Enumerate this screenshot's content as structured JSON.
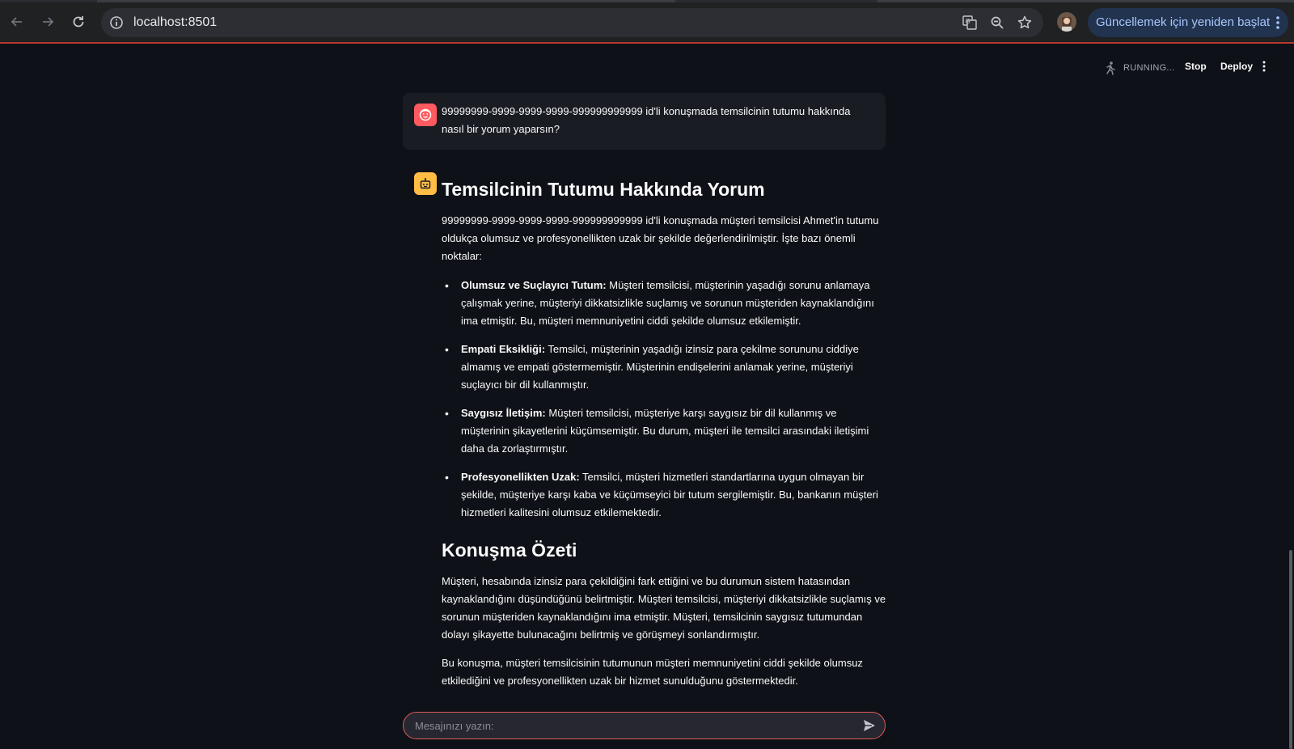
{
  "browser": {
    "url": "localhost:8501",
    "update_button_label": "Güncellemek için yeniden başlat"
  },
  "header": {
    "status_text": "RUNNING...",
    "stop_label": "Stop",
    "deploy_label": "Deploy"
  },
  "user_message": {
    "text": "99999999-9999-9999-9999-999999999999 id'li konuşmada temsilcinin tutumu hakkında nasıl bir yorum yaparsın?"
  },
  "assistant_message": {
    "heading": "Temsilcinin Tutumu Hakkında Yorum",
    "intro": "99999999-9999-9999-9999-999999999999 id'li konuşmada müşteri temsilcisi Ahmet'in tutumu oldukça olumsuz ve profesyonellikten uzak bir şekilde değerlendirilmiştir. İşte bazı önemli noktalar:",
    "points": [
      {
        "title": "Olumsuz ve Suçlayıcı Tutum:",
        "text": " Müşteri temsilcisi, müşterinin yaşadığı sorunu anlamaya çalışmak yerine, müşteriyi dikkatsizlikle suçlamış ve sorunun müşteriden kaynaklandığını ima etmiştir. Bu, müşteri memnuniyetini ciddi şekilde olumsuz etkilemiştir."
      },
      {
        "title": "Empati Eksikliği:",
        "text": " Temsilci, müşterinin yaşadığı izinsiz para çekilme sorununu ciddiye almamış ve empati göstermemiştir. Müşterinin endişelerini anlamak yerine, müşteriyi suçlayıcı bir dil kullanmıştır."
      },
      {
        "title": "Saygısız İletişim:",
        "text": " Müşteri temsilcisi, müşteriye karşı saygısız bir dil kullanmış ve müşterinin şikayetlerini küçümsemiştir. Bu durum, müşteri ile temsilci arasındaki iletişimi daha da zorlaştırmıştır."
      },
      {
        "title": "Profesyonellikten Uzak:",
        "text": " Temsilci, müşteri hizmetleri standartlarına uygun olmayan bir şekilde, müşteriye karşı kaba ve küçümseyici bir tutum sergilemiştir. Bu, bankanın müşteri hizmetleri kalitesini olumsuz etkilemektedir."
      }
    ],
    "summary_heading": "Konuşma Özeti",
    "summary_p1": "Müşteri, hesabında izinsiz para çekildiğini fark ettiğini ve bu durumun sistem hatasından kaynaklandığını düşündüğünü belirtmiştir. Müşteri temsilcisi, müşteriyi dikkatsizlikle suçlamış ve sorunun müşteriden kaynaklandığını ima etmiştir. Müşteri, temsilcinin saygısız tutumundan dolayı şikayette bulunacağını belirtmiş ve görüşmeyi sonlandırmıştır.",
    "summary_p2": "Bu konuşma, müşteri temsilcisinin tutumunun müşteri memnuniyetini ciddi şekilde olumsuz etkilediğini ve profesyonellikten uzak bir hizmet sunulduğunu göstermektedir."
  },
  "chat_input": {
    "placeholder": "Mesajınızı yazın:",
    "value": ""
  },
  "colors": {
    "background": "#0e1117",
    "user_avatar": "#ff5a5f",
    "assistant_avatar": "#ffbd45",
    "input_border": "#e05b55"
  },
  "icons": [
    "back-arrow-icon",
    "forward-arrow-icon",
    "reload-icon",
    "info-icon",
    "translate-icon",
    "zoom-icon",
    "bookmark-star-icon",
    "kebab-menu-icon",
    "running-person-icon",
    "user-face-icon",
    "robot-icon",
    "send-icon"
  ]
}
